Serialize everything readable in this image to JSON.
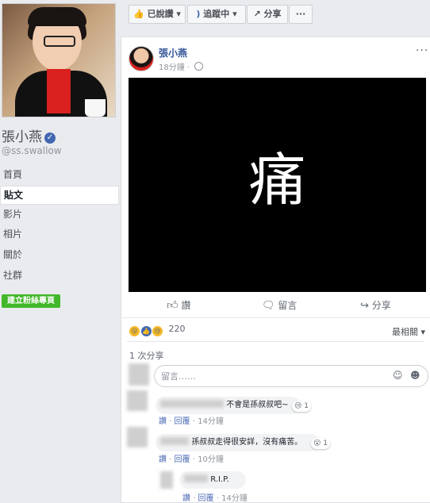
{
  "profile": {
    "name": "張小燕",
    "handle": "@ss.swallow",
    "nav": [
      {
        "label": "首頁"
      },
      {
        "label": "貼文"
      },
      {
        "label": "影片"
      },
      {
        "label": "相片"
      },
      {
        "label": "關於"
      },
      {
        "label": "社群"
      }
    ],
    "create_page_label": "建立粉絲專頁"
  },
  "topbar": {
    "liked_label": "已說讚",
    "following_label": "追蹤中",
    "share_label": "分享",
    "more_label": "···"
  },
  "post": {
    "author": "張小燕",
    "time": "18分鐘",
    "image_text": "痛",
    "like_label": "讚",
    "comment_label": "留言",
    "share_label": "分享",
    "reaction_count": "220",
    "sort_label": "最相關",
    "share_count": "1 次分享",
    "comment_placeholder": "留言……"
  },
  "comments": [
    {
      "text": "不會是孫叔叔吧~",
      "like": "讚",
      "reply": "回覆",
      "time": "14分鐘",
      "reaction_count": "1"
    },
    {
      "text": "孫叔叔走得很安詳，沒有痛苦。",
      "like": "讚",
      "reply": "回覆",
      "time": "10分鐘",
      "reaction_count": "1"
    },
    {
      "text": "R.I.P.",
      "like": "讚",
      "reply": "回覆",
      "time": "14分鐘"
    }
  ],
  "colors": {
    "link_blue": "#365899",
    "page_bg": "#e9ebee",
    "green_button": "#42b72a"
  }
}
